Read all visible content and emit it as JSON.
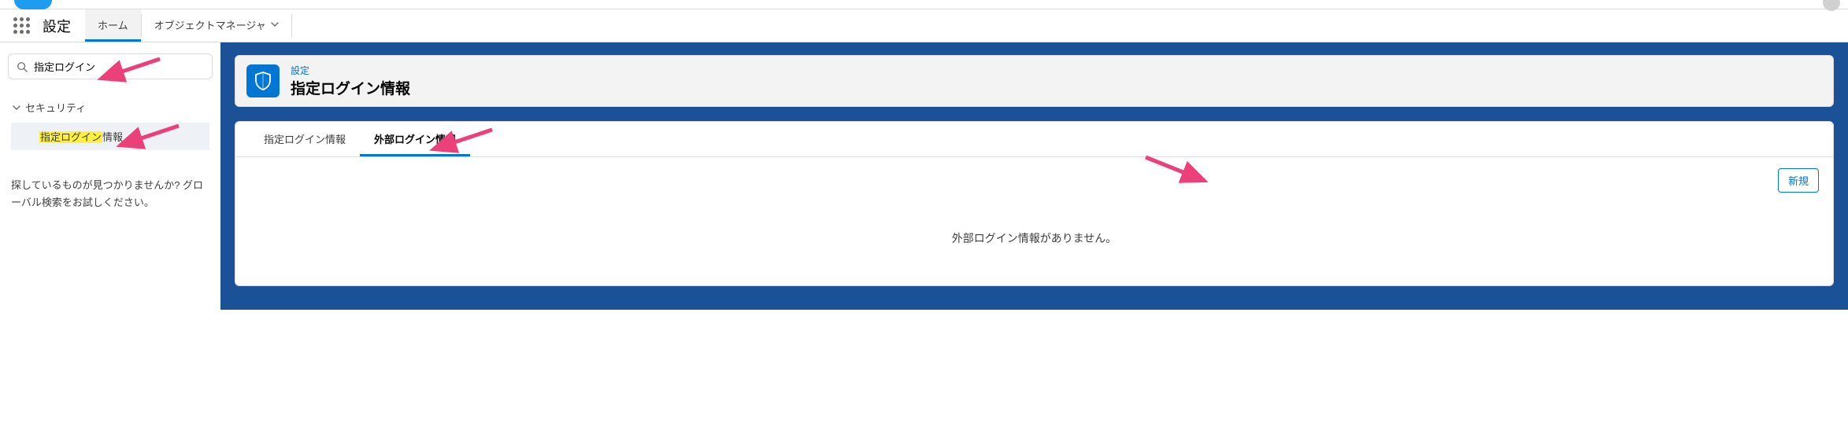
{
  "nav": {
    "app_name": "設定",
    "tabs": [
      {
        "label": "ホーム",
        "active": true
      },
      {
        "label": "オブジェクトマネージャ",
        "active": false,
        "has_dropdown": true
      }
    ]
  },
  "sidebar": {
    "search_value": "指定ログイン",
    "tree": {
      "section_label": "セキュリティ",
      "item_highlight": "指定ログイン",
      "item_suffix": "情報"
    },
    "help_text": "探しているものが見つかりませんか? グローバル検索をお試しください。"
  },
  "page_header": {
    "eyebrow": "設定",
    "title": "指定ログイン情報"
  },
  "subtabs": [
    {
      "label": "指定ログイン情報",
      "active": false
    },
    {
      "label": "外部ログイン情報",
      "active": true
    }
  ],
  "actions": {
    "new_label": "新規"
  },
  "empty_state": "外部ログイン情報がありません。"
}
